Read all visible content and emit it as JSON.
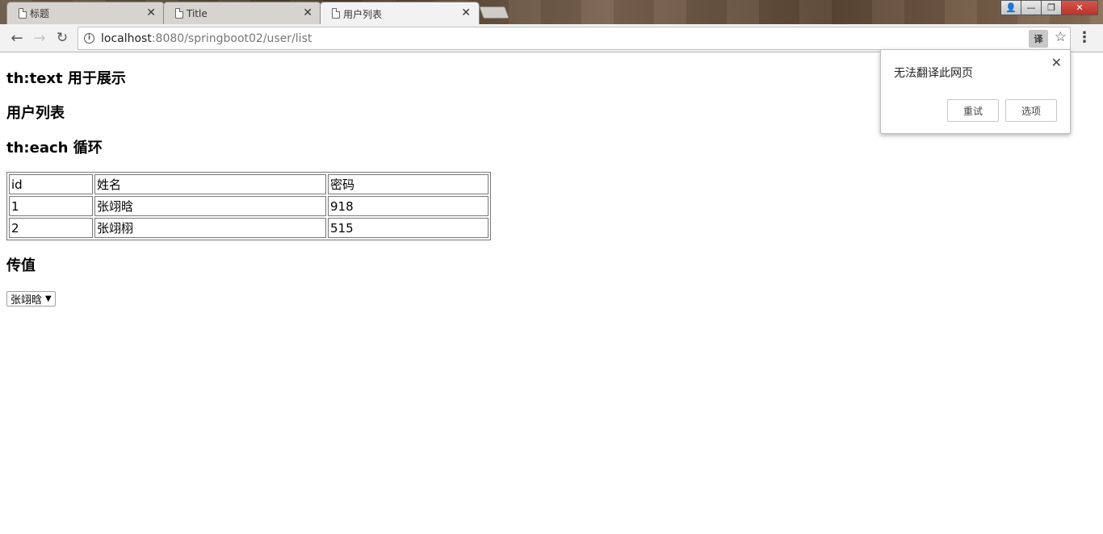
{
  "browser": {
    "tabs": [
      {
        "label": "标题",
        "close": "✕"
      },
      {
        "label": "Title",
        "close": "✕"
      },
      {
        "label": "用户列表",
        "close": "✕"
      }
    ],
    "window_controls": {
      "user": "👤",
      "minimize": "—",
      "restore": "❐",
      "close": "✕"
    },
    "nav": {
      "back": "←",
      "forward": "→",
      "reload": "↻"
    },
    "url_host": "localhost",
    "url_rest": ":8080/springboot02/user/list",
    "star": "☆",
    "menu": "⋮"
  },
  "translate_popup": {
    "message": "无法翻译此网页",
    "close": "✕",
    "retry_label": "重试",
    "options_label": "选项"
  },
  "page": {
    "heading1": "th:text 用于展示",
    "heading2": "用户列表",
    "heading3": "th:each 循环",
    "table": {
      "headers": [
        "id",
        "姓名",
        "密码"
      ],
      "rows": [
        [
          "1",
          "张翊晗",
          "918"
        ],
        [
          "2",
          "张翊栩",
          "515"
        ]
      ]
    },
    "heading4": "传值",
    "select_value": "张翊晗"
  }
}
